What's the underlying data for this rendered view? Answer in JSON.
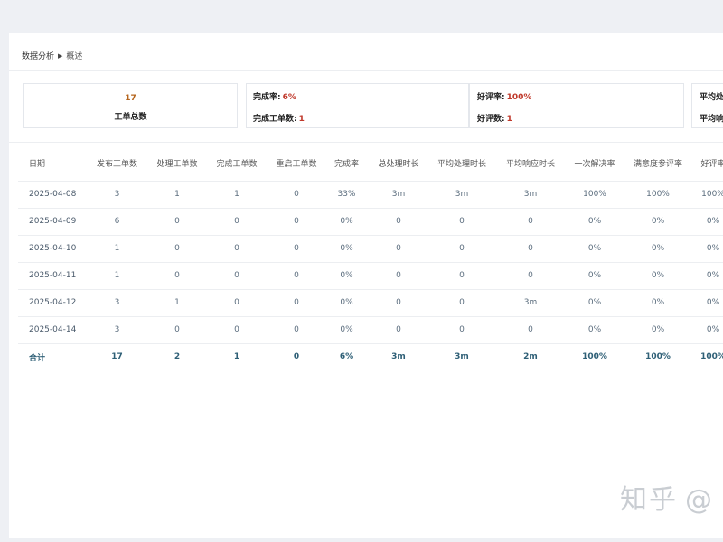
{
  "breadcrumb": {
    "root": "数据分析",
    "separator": "▶",
    "current": "概述"
  },
  "summary": {
    "total": {
      "value": "17",
      "label": "工单总数"
    },
    "completion_rate": {
      "label": "完成率:",
      "value": "6%"
    },
    "completed_count": {
      "label": "完成工单数:",
      "value": "1"
    },
    "good_rate": {
      "label": "好评率:",
      "value": "100%"
    },
    "good_count": {
      "label": "好评数:",
      "value": "1"
    },
    "avg_handle": {
      "label": "平均处"
    },
    "avg_response": {
      "label": "平均响"
    }
  },
  "table": {
    "columns": [
      "日期",
      "发布工单数",
      "处理工单数",
      "完成工单数",
      "重启工单数",
      "完成率",
      "总处理时长",
      "平均处理时长",
      "平均响应时长",
      "一次解决率",
      "满意度参评率",
      "好评率"
    ],
    "rows": [
      [
        "2025-04-08",
        "3",
        "1",
        "1",
        "0",
        "33%",
        "3m",
        "3m",
        "3m",
        "100%",
        "100%",
        "100%"
      ],
      [
        "2025-04-09",
        "6",
        "0",
        "0",
        "0",
        "0%",
        "0",
        "0",
        "0",
        "0%",
        "0%",
        "0%"
      ],
      [
        "2025-04-10",
        "1",
        "0",
        "0",
        "0",
        "0%",
        "0",
        "0",
        "0",
        "0%",
        "0%",
        "0%"
      ],
      [
        "2025-04-11",
        "1",
        "0",
        "0",
        "0",
        "0%",
        "0",
        "0",
        "0",
        "0%",
        "0%",
        "0%"
      ],
      [
        "2025-04-12",
        "3",
        "1",
        "0",
        "0",
        "0%",
        "0",
        "0",
        "3m",
        "0%",
        "0%",
        "0%"
      ],
      [
        "2025-04-14",
        "3",
        "0",
        "0",
        "0",
        "0%",
        "0",
        "0",
        "0",
        "0%",
        "0%",
        "0%"
      ]
    ],
    "total": [
      "合计",
      "17",
      "2",
      "1",
      "0",
      "6%",
      "3m",
      "3m",
      "2m",
      "100%",
      "100%",
      "100%"
    ]
  },
  "watermark": {
    "text": "知乎",
    "suffix": "@"
  },
  "colors": {
    "accent_value": "#c0392b",
    "total_value": "#b5651d",
    "total_row": "#2e5f76",
    "cell_text": "#5b6d7e"
  }
}
